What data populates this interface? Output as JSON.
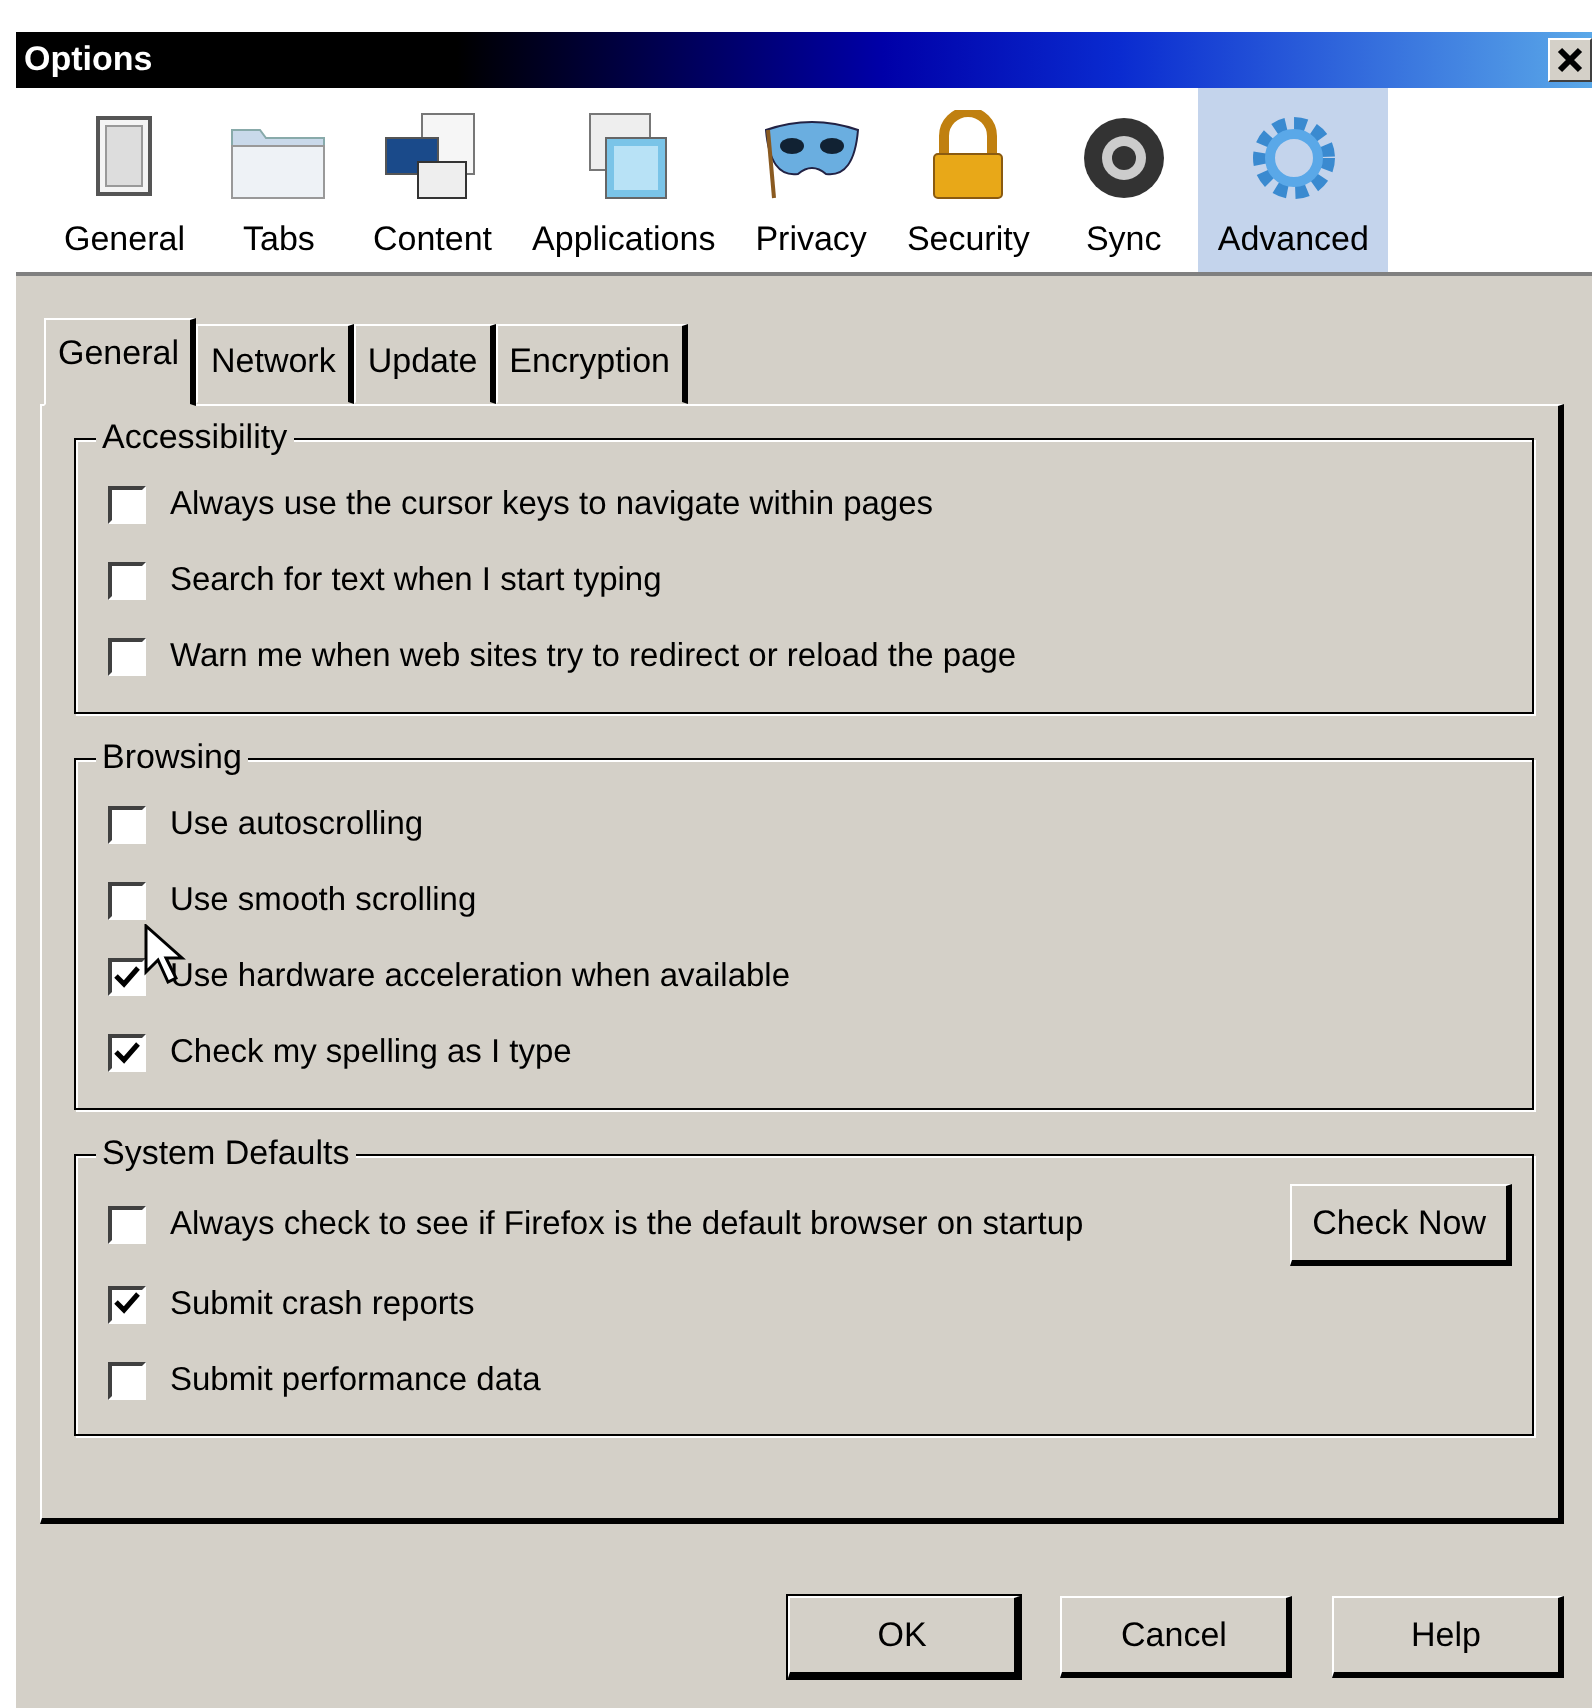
{
  "window": {
    "title": "Options"
  },
  "toolbar": [
    {
      "label": "General",
      "selected": false
    },
    {
      "label": "Tabs",
      "selected": false
    },
    {
      "label": "Content",
      "selected": false
    },
    {
      "label": "Applications",
      "selected": false
    },
    {
      "label": "Privacy",
      "selected": false
    },
    {
      "label": "Security",
      "selected": false
    },
    {
      "label": "Sync",
      "selected": false
    },
    {
      "label": "Advanced",
      "selected": true
    }
  ],
  "tabs": [
    {
      "label": "General",
      "selected": true
    },
    {
      "label": "Network",
      "selected": false
    },
    {
      "label": "Update",
      "selected": false
    },
    {
      "label": "Encryption",
      "selected": false
    }
  ],
  "groups": [
    {
      "title": "Accessibility",
      "options": [
        {
          "label": "Always use the cursor keys to navigate within pages",
          "checked": false
        },
        {
          "label": "Search for text when I start typing",
          "checked": false
        },
        {
          "label": "Warn me when web sites try to redirect or reload the page",
          "checked": false
        }
      ]
    },
    {
      "title": "Browsing",
      "options": [
        {
          "label": "Use autoscrolling",
          "checked": false
        },
        {
          "label": "Use smooth scrolling",
          "checked": false
        },
        {
          "label": "Use hardware acceleration when available",
          "checked": true
        },
        {
          "label": "Check my spelling as I type",
          "checked": true
        }
      ]
    },
    {
      "title": "System Defaults",
      "options": [
        {
          "label": "Always check to see if Firefox is the default browser on startup",
          "checked": false,
          "button": "Check Now"
        },
        {
          "label": "Submit crash reports",
          "checked": true
        },
        {
          "label": "Submit performance data",
          "checked": false
        }
      ]
    }
  ],
  "buttons": [
    {
      "label": "OK",
      "default": true
    },
    {
      "label": "Cancel",
      "default": false
    },
    {
      "label": "Help",
      "default": false
    }
  ]
}
